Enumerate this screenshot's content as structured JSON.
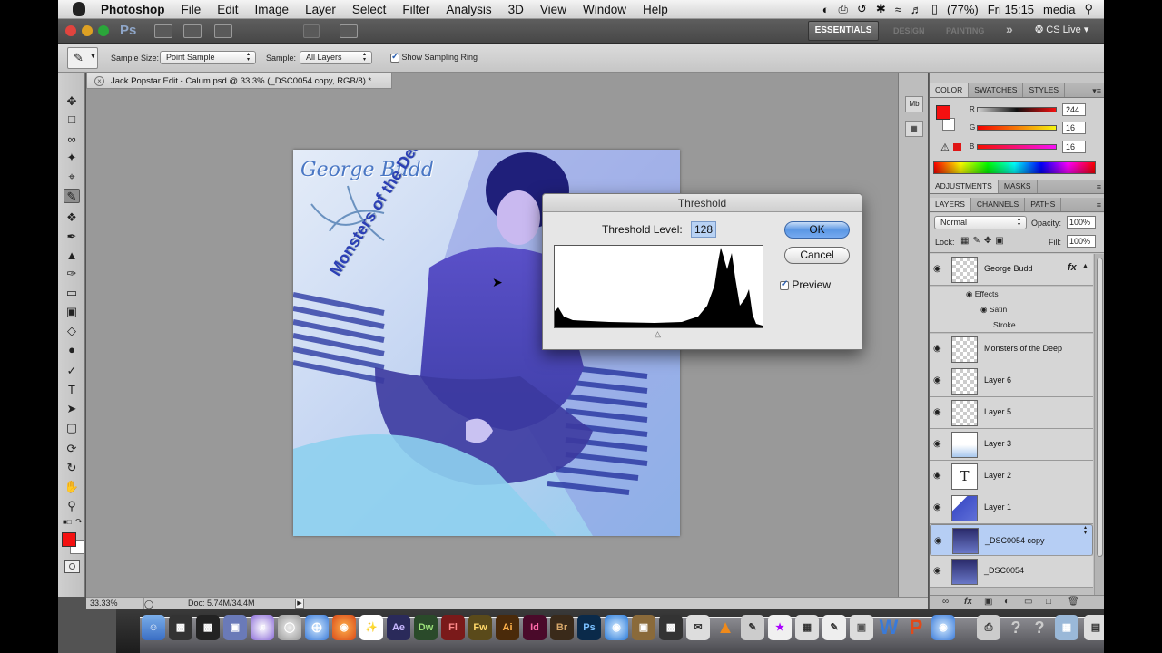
{
  "menubar": {
    "app": "Photoshop",
    "items": [
      "File",
      "Edit",
      "Image",
      "Layer",
      "Select",
      "Filter",
      "Analysis",
      "3D",
      "View",
      "Window",
      "Help"
    ],
    "battery": "(77%)",
    "clock": "Fri 15:15",
    "user": "media"
  },
  "appbar": {
    "workspace": "ESSENTIALS",
    "ws_design": "DESIGN",
    "ws_painting": "PAINTING",
    "more": "»",
    "cslive": "CS Live"
  },
  "options": {
    "sample_size_label": "Sample Size:",
    "sample_size_value": "Point Sample",
    "sample_label": "Sample:",
    "sample_value": "All Layers",
    "sampling_ring_label": "Show Sampling Ring",
    "sampling_ring_checked": true
  },
  "document": {
    "tab_title": "Jack Popstar Edit - Calum.psd @ 33.3% (_DSC0054 copy, RGB/8) *",
    "zoom": "33.33%",
    "doc_size": "Doc: 5.74M/34.4M"
  },
  "artwork": {
    "title": "George Budd",
    "subtitle": "Monsters of the Deep"
  },
  "dialog": {
    "title": "Threshold",
    "level_label": "Threshold Level:",
    "level_value": "128",
    "ok": "OK",
    "cancel": "Cancel",
    "preview_label": "Preview",
    "preview_checked": true
  },
  "color_panel": {
    "tabs": [
      "COLOR",
      "SWATCHES",
      "STYLES"
    ],
    "r_label": "R",
    "g_label": "G",
    "b_label": "B",
    "r": "244",
    "g": "16",
    "b": "16",
    "foreground": "#f41010"
  },
  "adjustments_tabs": [
    "ADJUSTMENTS",
    "MASKS"
  ],
  "layers_panel": {
    "tabs": [
      "LAYERS",
      "CHANNELS",
      "PATHS"
    ],
    "blend_mode": "Normal",
    "opacity_label": "Opacity:",
    "opacity": "100%",
    "lock_label": "Lock:",
    "fill_label": "Fill:",
    "fill": "100%",
    "layers": [
      {
        "name": "George Budd",
        "fx": "fx"
      },
      {
        "name": "Monsters of the Deep"
      },
      {
        "name": "Layer 6"
      },
      {
        "name": "Layer 5"
      },
      {
        "name": "Layer 3"
      },
      {
        "name": "Layer 2"
      },
      {
        "name": "Layer 1"
      },
      {
        "name": "_DSC0054 copy"
      },
      {
        "name": "_DSC0054"
      }
    ],
    "effects": "Effects",
    "effect_items": [
      "Satin",
      "Stroke"
    ],
    "type_glyph": "T"
  },
  "dock": {
    "apps": [
      "Ae",
      "Dw",
      "Fl",
      "Fw",
      "Ai",
      "Id",
      "Br",
      "Ps"
    ]
  },
  "icons": {
    "eye": "eye-icon",
    "apple": "apple-icon",
    "search": "search-icon"
  }
}
